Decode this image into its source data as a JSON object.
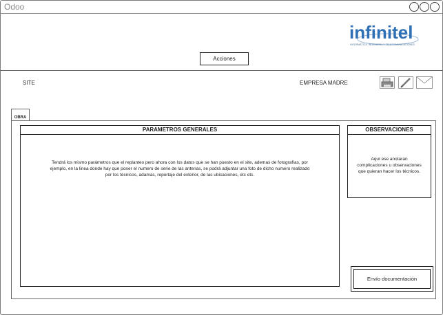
{
  "window": {
    "title": "Odoo"
  },
  "brand": {
    "name": "infinitel",
    "tagline": "INFORMÁTICA, INGENIERÍA Y TELECOMUNICACIONES",
    "color": "#2f6fb3"
  },
  "header": {
    "actions_label": "Acciones"
  },
  "info": {
    "site_label": "SITE",
    "company_label": "EMPRESA MADRE"
  },
  "toolbar": {
    "icons": [
      "printer-icon",
      "edit-icon",
      "mail-icon"
    ]
  },
  "tabs": [
    {
      "label": "OBRA",
      "active": true
    }
  ],
  "general": {
    "title": "PARAMETROS GENERALES",
    "lines": [
      "Tendrá los mismo parámetros que el replanteo pero ahora con los datos que se han puesto en el site, ademas de fotografías, por",
      "ejemplo, en la linea donde hay que poner el numero de serie de las antenas, se podrá adjuntar una foto de dicho numero realizado",
      "por los técnicos, adamas,  reportaje del exterior, de las ubicaciones, etc etc."
    ]
  },
  "observations": {
    "title": "OBSERVACIONES",
    "lines": [
      "Aquí ese anotaran",
      "complicaciones u observaciones",
      "que quieran hacer los técnicos."
    ]
  },
  "footer": {
    "send_label": "Envío documentación"
  }
}
